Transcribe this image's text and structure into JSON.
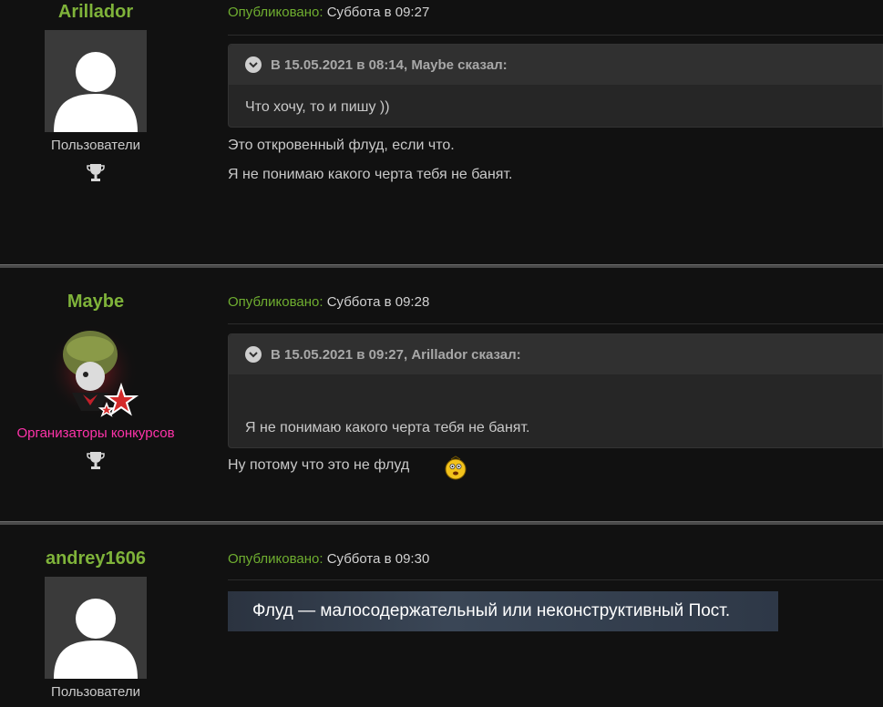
{
  "posts": [
    {
      "username": "Arillador",
      "group": "Пользователи",
      "published_label": "Опубликовано:",
      "date": "Суббота в 09:27",
      "quote": {
        "header": "В 15.05.2021 в 08:14, Maybe сказал:",
        "body": "Что хочу, то и пишу ))"
      },
      "lines": [
        "Это откровенный флуд, если что.",
        "Я не понимаю какого черта тебя не банят."
      ]
    },
    {
      "username": "Maybe",
      "group": "Организаторы конкурсов",
      "published_label": "Опубликовано:",
      "date": "Суббота в 09:28",
      "quote": {
        "header": "В 15.05.2021 в 09:27, Arillador сказал:",
        "body": "Я не понимаю какого черта тебя не банят."
      },
      "lines": [
        "Ну потому что это не флуд"
      ]
    },
    {
      "username": "andrey1606",
      "group": "Пользователи",
      "published_label": "Опубликовано:",
      "date": "Суббота в 09:30",
      "banner": "Флуд — малосодержательный или неконструктивный Пост."
    }
  ],
  "colors": {
    "username": "#7fb33a",
    "published_label": "#6fae30",
    "organizer_group": "#ff33aa",
    "background": "#111111"
  }
}
